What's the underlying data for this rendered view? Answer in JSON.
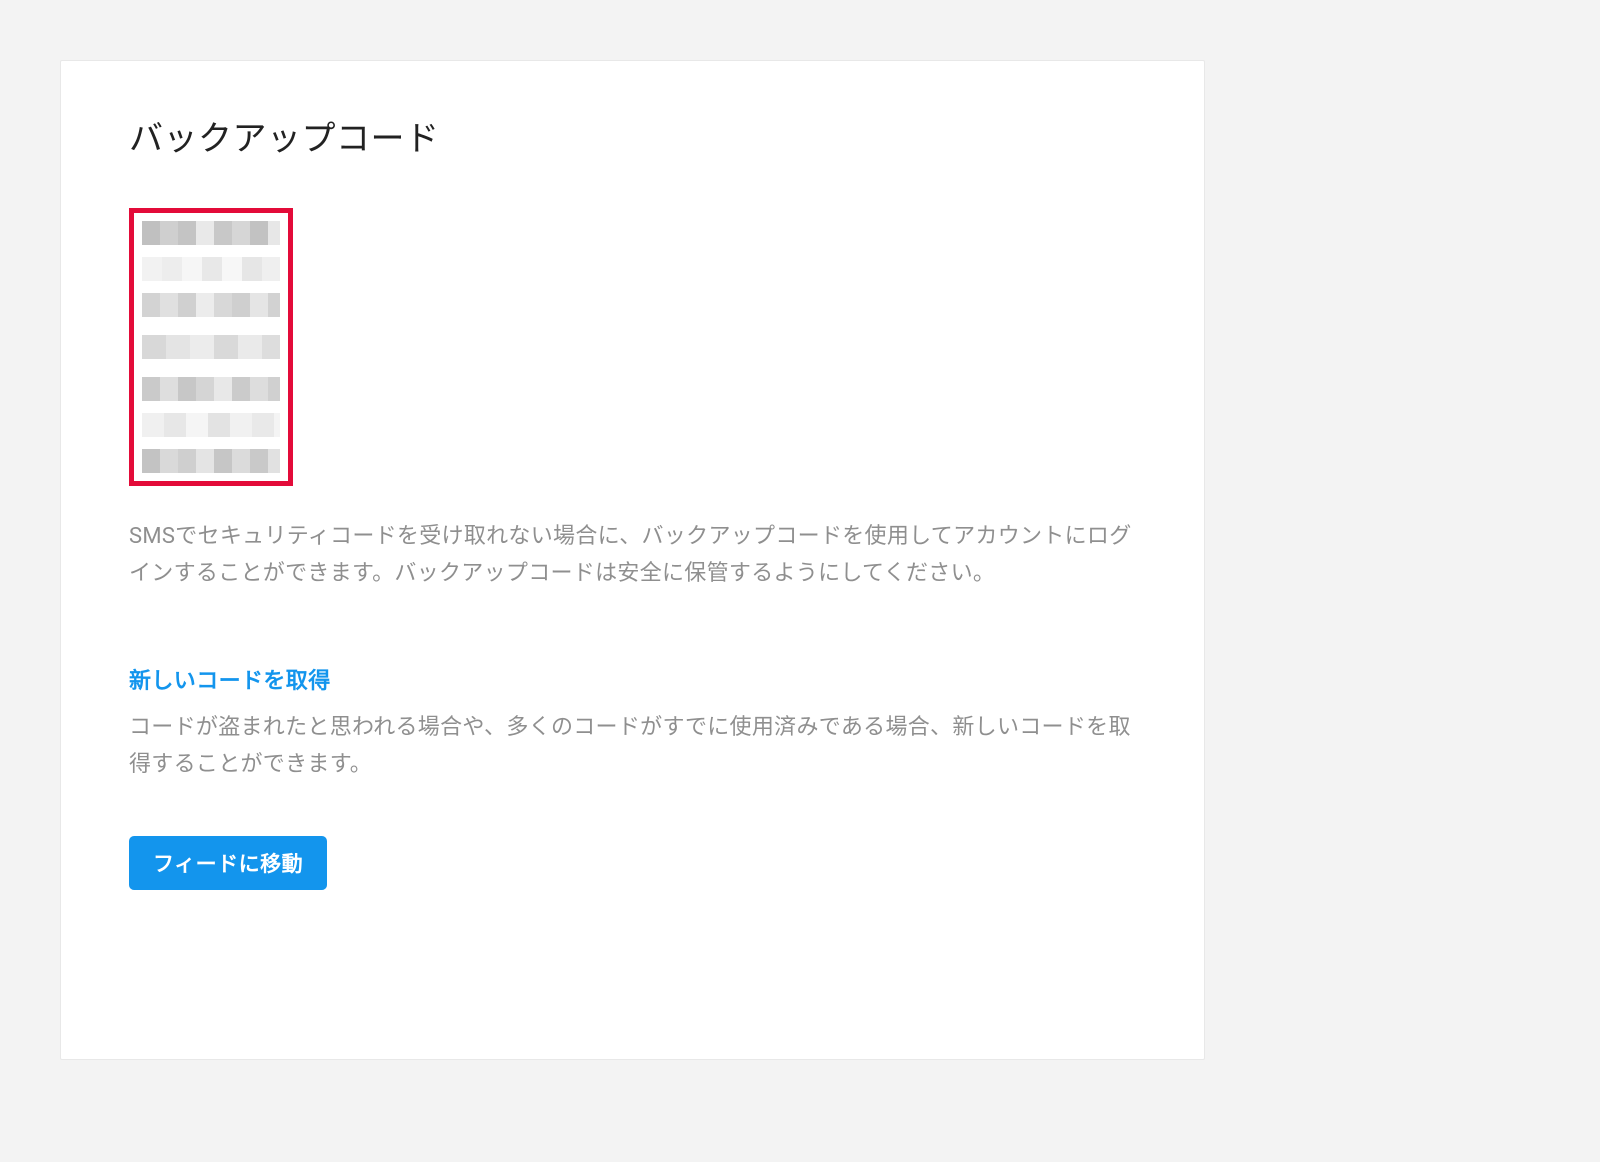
{
  "header": {
    "title": "バックアップコード"
  },
  "description": "SMSでセキュリティコードを受け取れない場合に、バックアップコードを使用してアカウントにログインすることができます。バックアップコードは安全に保管するようにしてください。",
  "newCodes": {
    "heading": "新しいコードを取得",
    "text": "コードが盗まれたと思われる場合や、多くのコードがすでに使用済みである場合、新しいコードを取得することができます。"
  },
  "actions": {
    "goToFeed": "フィードに移動"
  },
  "codes": {
    "redacted": true
  }
}
